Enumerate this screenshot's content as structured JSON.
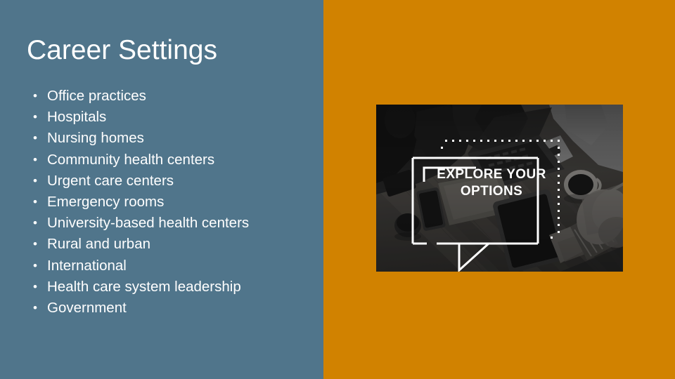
{
  "slide": {
    "title": "Career Settings",
    "background_left_color": "#50758B",
    "background_right_color": "#D18200",
    "text_color": "#FFFFFF"
  },
  "bullets": {
    "marker": "•",
    "items": [
      {
        "label": "Office practices"
      },
      {
        "label": "Hospitals"
      },
      {
        "label": "Nursing homes"
      },
      {
        "label": "Community health centers"
      },
      {
        "label": "Urgent care centers"
      },
      {
        "label": "Emergency rooms"
      },
      {
        "label": "University-based health centers"
      },
      {
        "label": "Rural and urban"
      },
      {
        "label": "International"
      },
      {
        "label": "Health care system leadership"
      },
      {
        "label": "Government"
      }
    ]
  },
  "photo": {
    "alt_description": "Black and white overhead photo of people around a wooden table with a laptop, tablet, smartphone and coffee cups",
    "overlay": {
      "line1": "EXPLORE YOUR",
      "line2": "OPTIONS",
      "overlay_color": "#FFFFFF"
    }
  }
}
